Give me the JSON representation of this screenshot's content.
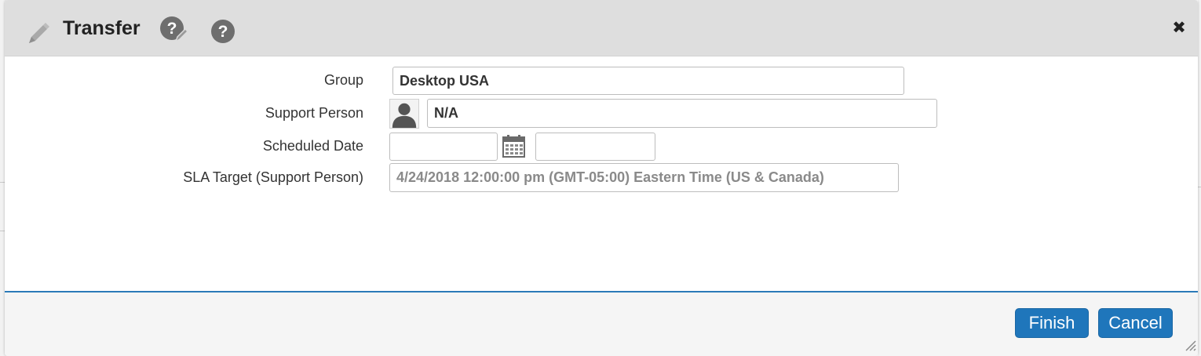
{
  "dialog": {
    "title": "Transfer",
    "icons": {
      "title": "pencil-icon",
      "help_edit": "help-edit-icon",
      "help": "help-icon",
      "close": "close-icon"
    },
    "close_glyph": "✖"
  },
  "form": {
    "group": {
      "label": "Group",
      "value": "Desktop USA"
    },
    "support_person": {
      "label": "Support Person",
      "value": "N/A",
      "icon": "person-avatar-icon"
    },
    "scheduled_date": {
      "label": "Scheduled Date",
      "date_value": "",
      "time_value": "",
      "icon": "calendar-icon"
    },
    "sla_target": {
      "label": "SLA Target (Support Person)",
      "value": "4/24/2018 12:00:00 pm (GMT-05:00) Eastern Time (US & Canada)"
    }
  },
  "footer": {
    "finish_label": "Finish",
    "cancel_label": "Cancel"
  },
  "colors": {
    "accent": "#1f76bb",
    "titlebar_bg": "#dedede",
    "footer_border": "#2b7ab8"
  }
}
